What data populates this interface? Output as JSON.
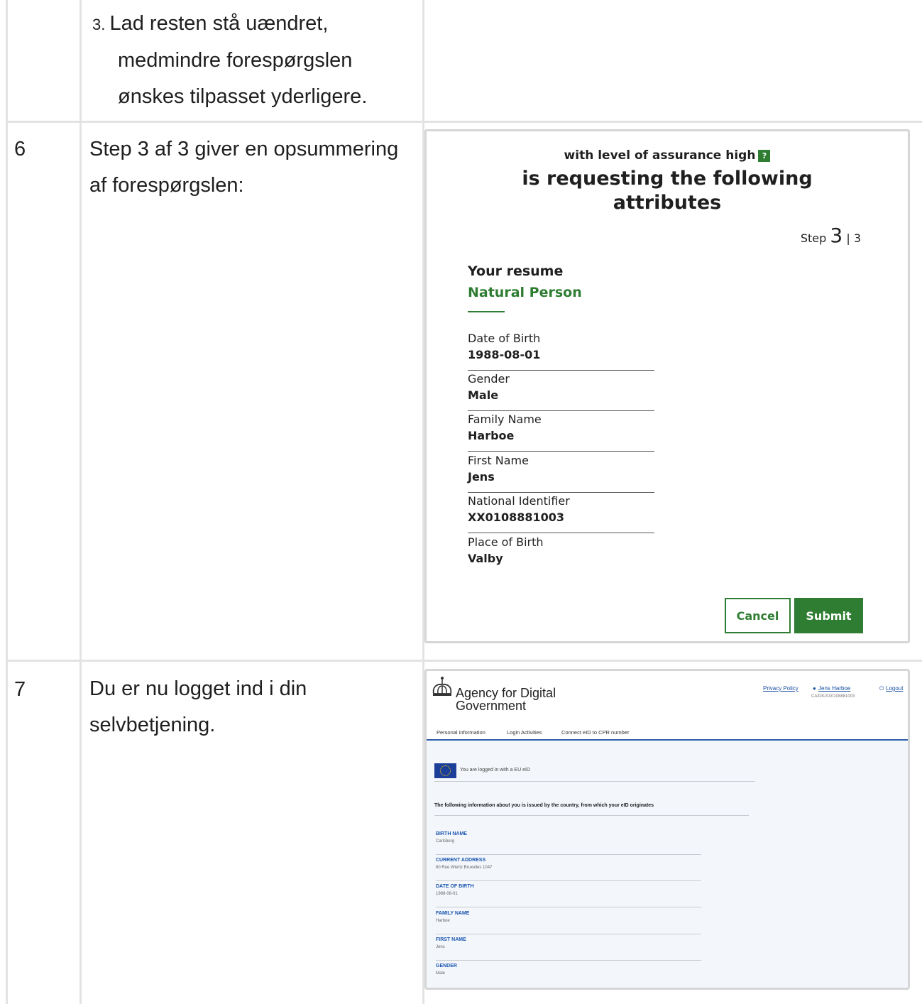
{
  "rows": [
    {
      "number": "",
      "lines": [
        "3. Lad resten stå uændret,",
        "medmindre forespørgslen",
        "ønskes tilpasset yderligere."
      ]
    },
    {
      "number": "6",
      "lines": [
        "Step 3 af 3 giver en opsummering",
        "af forespørgslen:"
      ]
    },
    {
      "number": "7",
      "lines": [
        "Du er nu logget ind i din",
        "selvbetjening."
      ]
    }
  ],
  "step3": {
    "loa_text": "with level of assurance high",
    "help_glyph": "?",
    "heading_line1": "is requesting the following",
    "heading_line2": "attributes",
    "step_prefix": "Step",
    "step_current": "3",
    "step_sep": "|",
    "step_total": "3",
    "resume_title": "Your resume",
    "person_type": "Natural Person",
    "fields": [
      {
        "label": "Date of Birth",
        "value": "1988-08-01"
      },
      {
        "label": "Gender",
        "value": "Male"
      },
      {
        "label": "Family Name",
        "value": "Harboe"
      },
      {
        "label": "First Name",
        "value": "Jens"
      },
      {
        "label": "National Identifier",
        "value": "XX0108881003"
      },
      {
        "label": "Place of Birth",
        "value": "Valby"
      }
    ],
    "cancel_label": "Cancel",
    "submit_label": "Submit",
    "accent_color": "#2e7d32"
  },
  "agency": {
    "logo_line1": "Agency for Digital",
    "logo_line2": "Government",
    "privacy_link": "Privacy Policy",
    "user_link": "Jens Harboe",
    "user_id": "CA/DK/XX0108881003",
    "logout_link": "Logout",
    "nav": [
      "Personal information",
      "Login Activities",
      "Connect eID to CPR number"
    ],
    "logged_in_text": "You are logged in with a EU eID",
    "info_text": "The following information about you is issued by the country, from which your eID originates",
    "fields": [
      {
        "label": "BIRTH NAME",
        "value": "Carlsberg"
      },
      {
        "label": "CURRENT ADDRESS",
        "value": "60 Rue Wiertz Bruxelles 1047"
      },
      {
        "label": "DATE OF BIRTH",
        "value": "1988-08-01"
      },
      {
        "label": "FAMILY NAME",
        "value": "Harboe"
      },
      {
        "label": "FIRST NAME",
        "value": "Jens"
      },
      {
        "label": "GENDER",
        "value": "Male"
      }
    ],
    "link_color": "#1a4fa0",
    "nav_line_color": "#2f5fa8"
  }
}
